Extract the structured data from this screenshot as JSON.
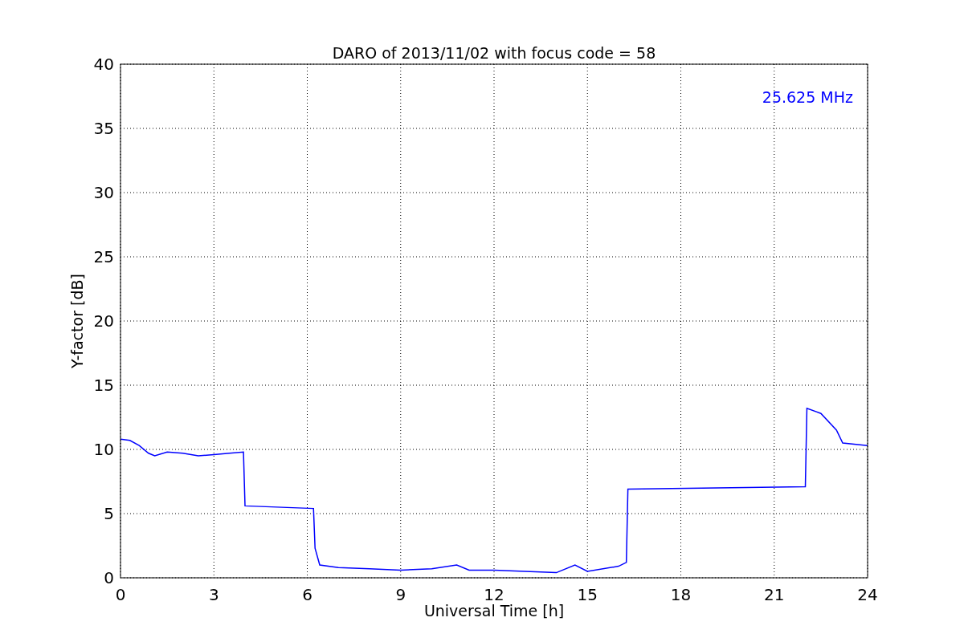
{
  "figure": {
    "chart_data": {
      "type": "line",
      "title": "DARO of 2013/11/02 with focus code = 58",
      "xlabel": "Universal Time [h]",
      "ylabel": "Y-factor [dB]",
      "x": [
        0,
        0.3,
        0.6,
        0.9,
        1.1,
        1.5,
        2,
        2.5,
        3,
        3.5,
        3.95,
        4.0,
        6.2,
        6.25,
        6.4,
        7,
        8,
        9,
        10,
        10.8,
        11.2,
        12,
        13,
        14,
        14.6,
        15,
        16,
        16.25,
        16.3,
        22,
        22.05,
        22.5,
        23,
        23.2,
        24
      ],
      "series": [
        {
          "name": "25.625 MHz",
          "color": "#0000ff",
          "values": [
            10.8,
            10.7,
            10.3,
            9.7,
            9.5,
            9.8,
            9.7,
            9.5,
            9.6,
            9.7,
            9.8,
            5.6,
            5.4,
            2.3,
            1.0,
            0.8,
            0.7,
            0.6,
            0.7,
            1.0,
            0.6,
            0.6,
            0.5,
            0.4,
            1.0,
            0.5,
            0.9,
            1.2,
            6.9,
            7.1,
            13.2,
            12.8,
            11.5,
            10.5,
            10.3
          ]
        }
      ],
      "xlim": [
        0,
        24
      ],
      "ylim": [
        0,
        40
      ],
      "xticks": [
        0,
        3,
        6,
        9,
        12,
        15,
        18,
        21,
        24
      ],
      "yticks": [
        0,
        5,
        10,
        15,
        20,
        25,
        30,
        35,
        40
      ],
      "grid": true
    }
  }
}
